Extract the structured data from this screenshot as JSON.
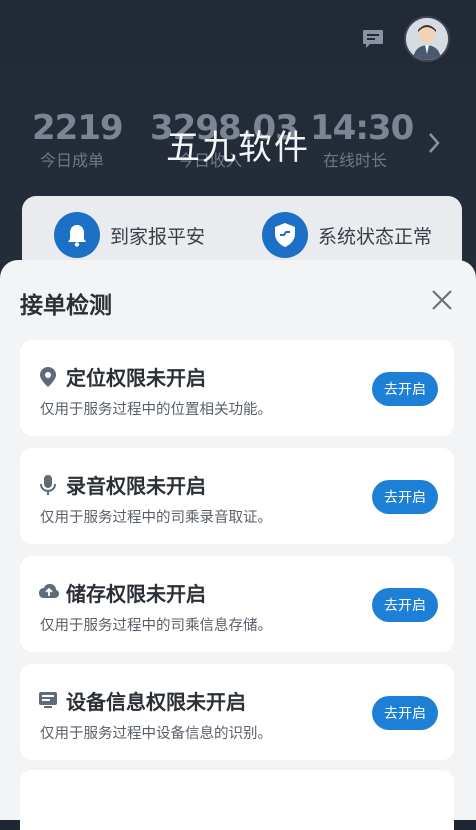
{
  "header": {
    "message_icon": "message-icon",
    "avatar_icon": "user-avatar"
  },
  "stats": [
    {
      "value": "2219",
      "label": "今日成单"
    },
    {
      "value": "3298.03",
      "label": "今日收入"
    },
    {
      "value": "14:30",
      "label": "在线时长"
    }
  ],
  "watermark": "五九软件",
  "status_card": {
    "items": [
      {
        "icon": "bell-icon",
        "label": "到家报平安"
      },
      {
        "icon": "shield-icon",
        "label": "系统状态正常"
      }
    ]
  },
  "sheet": {
    "title": "接单检测",
    "permissions": [
      {
        "icon": "location-pin-icon",
        "title": "定位权限未开启",
        "desc": "仅用于服务过程中的位置相关功能。",
        "button": "去开启"
      },
      {
        "icon": "microphone-icon",
        "title": "录音权限未开启",
        "desc": "仅用于服务过程中的司乘录音取证。",
        "button": "去开启"
      },
      {
        "icon": "cloud-upload-icon",
        "title": "储存权限未开启",
        "desc": "仅用于服务过程中的司乘信息存储。",
        "button": "去开启"
      },
      {
        "icon": "device-info-icon",
        "title": "设备信息权限未开启",
        "desc": "仅用于服务过程中设备信息的识别。",
        "button": "去开启"
      }
    ]
  },
  "colors": {
    "accent": "#1d7fd6",
    "dark_bg": "#222a38"
  }
}
